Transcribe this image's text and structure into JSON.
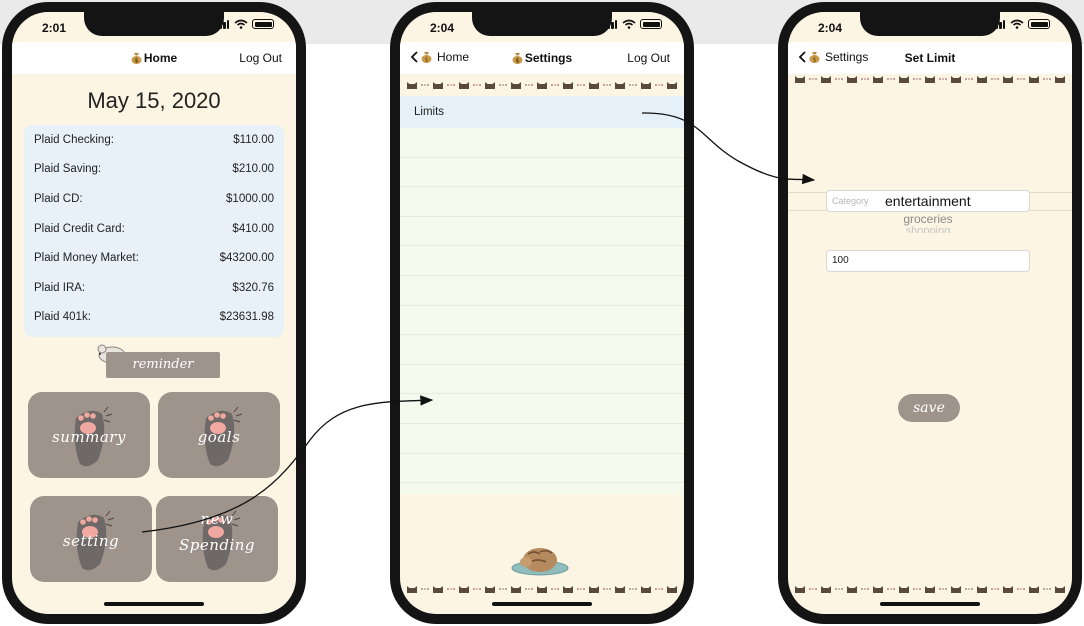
{
  "phone1": {
    "time": "2:01",
    "nav_title": "Home",
    "logout_label": "Log Out",
    "date": "May 15, 2020",
    "accounts": [
      {
        "name": "Plaid Checking:",
        "amount": "$110.00"
      },
      {
        "name": "Plaid Saving:",
        "amount": "$210.00"
      },
      {
        "name": "Plaid CD:",
        "amount": "$1000.00"
      },
      {
        "name": "Plaid Credit Card:",
        "amount": "$410.00"
      },
      {
        "name": "Plaid Money Market:",
        "amount": "$43200.00"
      },
      {
        "name": "Plaid IRA:",
        "amount": "$320.76"
      },
      {
        "name": "Plaid 401k:",
        "amount": "$23631.98"
      }
    ],
    "reminder_label": "reminder",
    "tiles": {
      "summary": "summary",
      "goals": "goals",
      "setting": "setting",
      "new_spending_line1": "new",
      "new_spending_line2": "Spending"
    }
  },
  "phone2": {
    "time": "2:04",
    "back_label": "Home",
    "nav_title": "Settings",
    "logout_label": "Log Out",
    "limits_label": "Limits"
  },
  "phone3": {
    "time": "2:04",
    "back_label": "Settings",
    "nav_title": "Set Limit",
    "category_placeholder": "Category",
    "picker_selected": "entertainment",
    "picker_next": "groceries",
    "picker_next2": "shopping",
    "amount_value": "100",
    "save_label": "save"
  },
  "colors": {
    "screen_bg": "#fdf5e4",
    "tile_gray": "#9f948c",
    "list_blue": "#e9f1f8",
    "paw_pink": "#f0a8a0",
    "cat_brown": "#5a4a3c"
  },
  "icons": [
    "money-bag-icon",
    "back-chevron-icon",
    "paw-icon",
    "mouse-icon",
    "cat-border-icon",
    "sleeping-cat-icon",
    "wifi-icon",
    "battery-icon",
    "signal-icon"
  ]
}
